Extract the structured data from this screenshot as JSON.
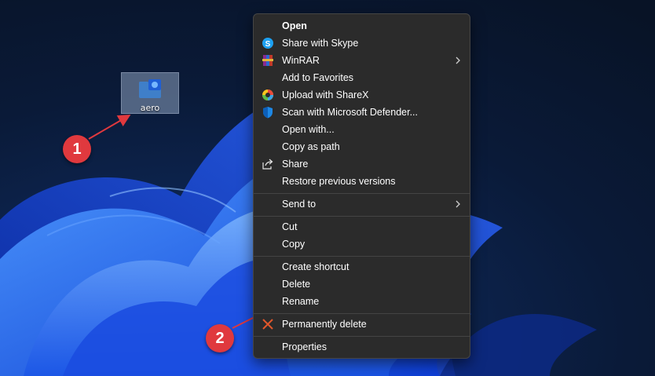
{
  "desktop": {
    "icon_label": "aero",
    "icon_name": "folder-app-icon"
  },
  "annotations": {
    "badge_1": "1",
    "badge_2": "2",
    "badge_color": "#e0393e"
  },
  "context_menu": {
    "items": [
      {
        "label": "Open",
        "icon": "none"
      },
      {
        "label": "Share with Skype",
        "icon": "skype-icon"
      },
      {
        "label": "WinRAR",
        "icon": "winrar-icon",
        "submenu": true
      },
      {
        "label": "Add to Favorites",
        "icon": "none"
      },
      {
        "label": "Upload with ShareX",
        "icon": "sharex-icon"
      },
      {
        "label": "Scan with Microsoft Defender...",
        "icon": "defender-shield-icon"
      },
      {
        "label": "Open with...",
        "icon": "none"
      },
      {
        "label": "Copy as path",
        "icon": "none"
      },
      {
        "label": "Share",
        "icon": "share-icon"
      },
      {
        "label": "Restore previous versions",
        "icon": "none"
      },
      {
        "label": "Send to",
        "icon": "none",
        "submenu": true
      },
      {
        "label": "Cut",
        "icon": "none"
      },
      {
        "label": "Copy",
        "icon": "none"
      },
      {
        "label": "Create shortcut",
        "icon": "none"
      },
      {
        "label": "Delete",
        "icon": "none"
      },
      {
        "label": "Rename",
        "icon": "none"
      },
      {
        "label": "Permanently delete",
        "icon": "close-x-icon"
      },
      {
        "label": "Properties",
        "icon": "none"
      }
    ],
    "colors": {
      "background": "#2b2b2b",
      "text": "#ffffff",
      "separator": "#444444"
    }
  }
}
